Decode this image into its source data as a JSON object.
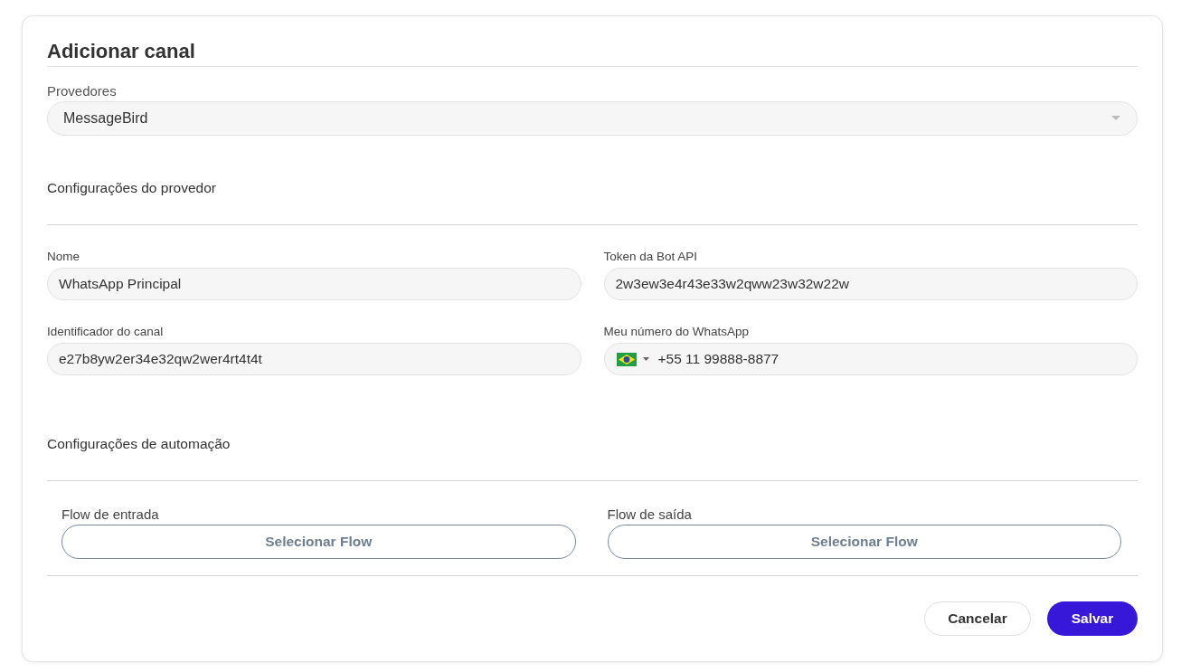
{
  "dialog": {
    "title": "Adicionar canal"
  },
  "provider": {
    "label": "Provedores",
    "value": "MessageBird"
  },
  "provider_settings": {
    "heading": "Configurações do provedor",
    "fields": [
      {
        "kind": "text",
        "label": "Nome",
        "value": "WhatsApp Principal"
      },
      {
        "kind": "text",
        "label": "Token da Bot API",
        "value": "2w3ew3e4r43e33w2qww23w32w22w"
      },
      {
        "kind": "text",
        "label": "Identificador do canal",
        "value": "e27b8yw2er34e32qw2wer4rt4t4t"
      },
      {
        "kind": "phone",
        "label": "Meu número do WhatsApp",
        "value": "+55 11 99888-8877"
      }
    ]
  },
  "automation_settings": {
    "heading": "Configurações de automação",
    "flows": [
      {
        "label": "Flow de entrada",
        "button": "Selecionar Flow"
      },
      {
        "label": "Flow de saída",
        "button": "Selecionar Flow"
      }
    ]
  },
  "buttons": [
    {
      "kind": "secondary",
      "label": "Cancelar"
    },
    {
      "kind": "primary",
      "label": "Salvar"
    }
  ]
}
